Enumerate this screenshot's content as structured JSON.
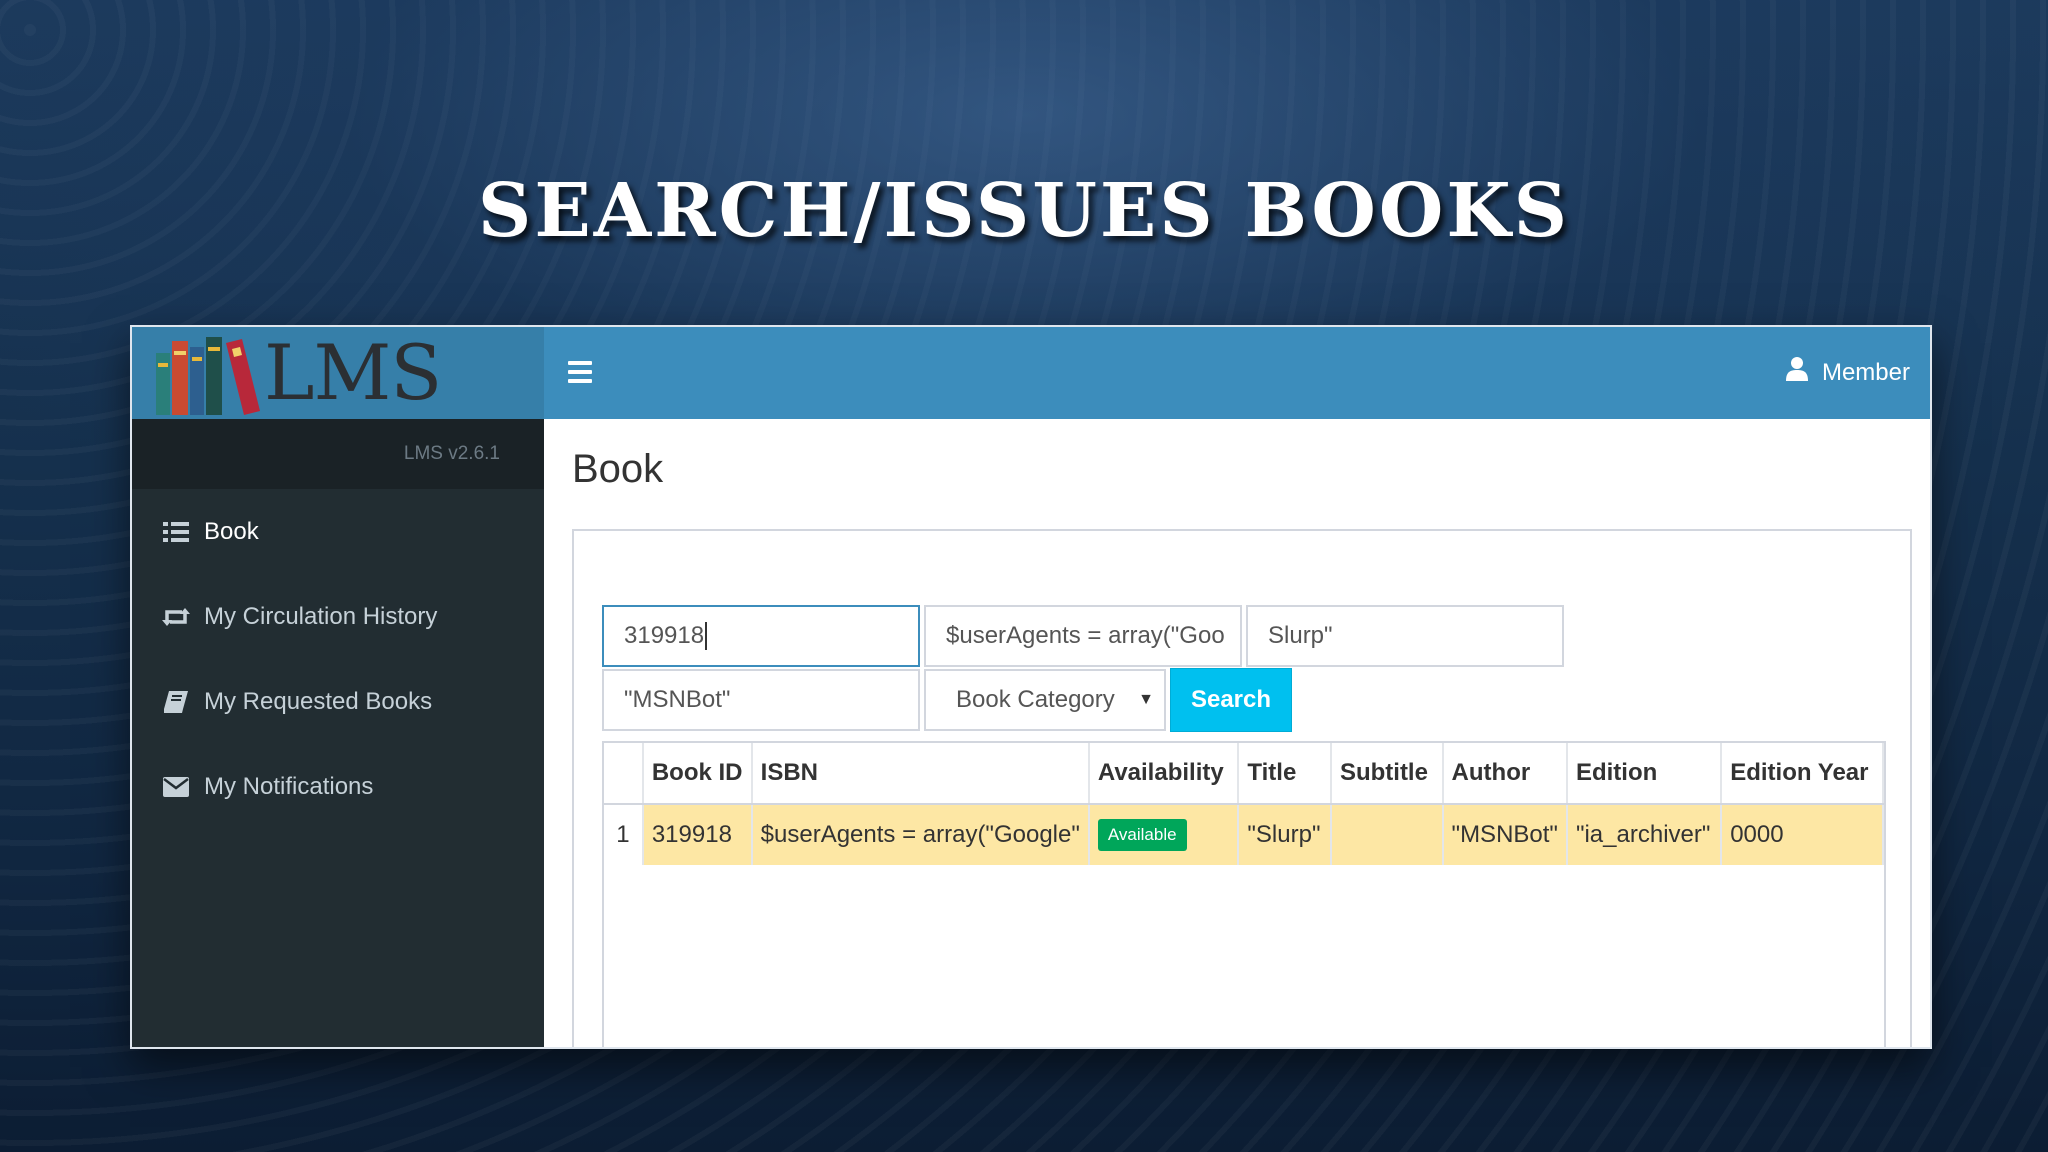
{
  "slide": {
    "title": "SEARCH/ISSUES BOOKS"
  },
  "app": {
    "logo_text": "LMS",
    "version": "LMS v2.6.1",
    "user_label": "Member"
  },
  "sidebar": {
    "items": [
      {
        "label": "Book",
        "icon": "list-icon"
      },
      {
        "label": "My Circulation History",
        "icon": "retweet-icon"
      },
      {
        "label": "My Requested Books",
        "icon": "book-icon"
      },
      {
        "label": "My Notifications",
        "icon": "envelope-icon"
      }
    ]
  },
  "main": {
    "page_title": "Book",
    "search": {
      "field1_value": "319918",
      "field2_value": "$userAgents = array(\"Goo",
      "field3_value": "Slurp\"",
      "field4_value": "\"MSNBot\"",
      "category_selected": "Book Category",
      "search_label": "Search"
    },
    "table": {
      "headers": [
        "",
        "Book ID",
        "ISBN",
        "Availability",
        "Title",
        "Subtitle",
        "Author",
        "Edition",
        "Edition Year"
      ],
      "rows": [
        {
          "num": "1",
          "book_id": "319918",
          "isbn": "$userAgents = array(\"Google\"",
          "availability": "Available",
          "title": "\"Slurp\"",
          "subtitle": "",
          "author": "\"MSNBot\"",
          "edition": "\"ia_archiver\"",
          "edition_year": "0000"
        }
      ]
    }
  },
  "colors": {
    "header": "#3c8dbc",
    "logo_bar": "#367fa9",
    "sidebar": "#222d32",
    "search_button": "#00c0ef",
    "available_badge": "#00a65a",
    "highlight_row": "#fde7a4"
  }
}
